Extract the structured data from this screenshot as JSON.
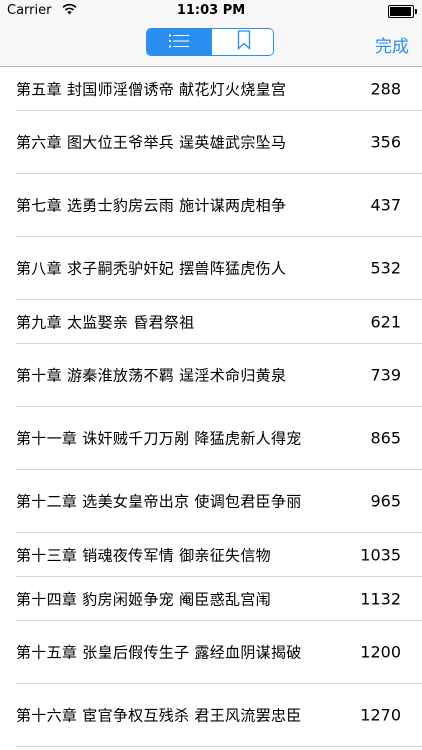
{
  "status_bar": {
    "carrier": "Carrier",
    "time": "11:03 PM",
    "battery_level": 0.95
  },
  "nav": {
    "segments": [
      {
        "icon": "list-icon",
        "selected": true
      },
      {
        "icon": "bookmark-icon",
        "selected": false
      }
    ],
    "done_label": "完成",
    "accent_color": "#2b8ff0"
  },
  "chapters": [
    {
      "title": "第五章  封国师淫僧诱帝  献花灯火烧皇宫",
      "page": "288"
    },
    {
      "title": "第六章  图大位王爷举兵  逞英雄武宗坠马",
      "page": "356"
    },
    {
      "title": "第七章  选勇士豹房云雨  施计谋两虎相争",
      "page": "437"
    },
    {
      "title": "第八章  求子嗣秃驴奸妃  摆兽阵猛虎伤人",
      "page": "532"
    },
    {
      "title": "第九章  太监娶亲  昏君祭祖",
      "page": "621"
    },
    {
      "title": "第十章  游秦淮放荡不羁  逞淫术命归黄泉",
      "page": "739"
    },
    {
      "title": "第十一章  诛奸贼千刀万剐  降猛虎新人得宠",
      "page": "865"
    },
    {
      "title": "第十二章  选美女皇帝出京  使调包君臣争丽",
      "page": "965"
    },
    {
      "title": "第十三章  销魂夜传军情  御亲征失信物",
      "page": "1035"
    },
    {
      "title": "第十四章  豹房闲姬争宠  阉臣惑乱宫闱",
      "page": "1132"
    },
    {
      "title": "第十五章  张皇后假传生子  露经血阴谋揭破",
      "page": "1200"
    },
    {
      "title": "第十六章  宦官争权互残杀  君王风流罢忠臣",
      "page": "1270"
    }
  ]
}
